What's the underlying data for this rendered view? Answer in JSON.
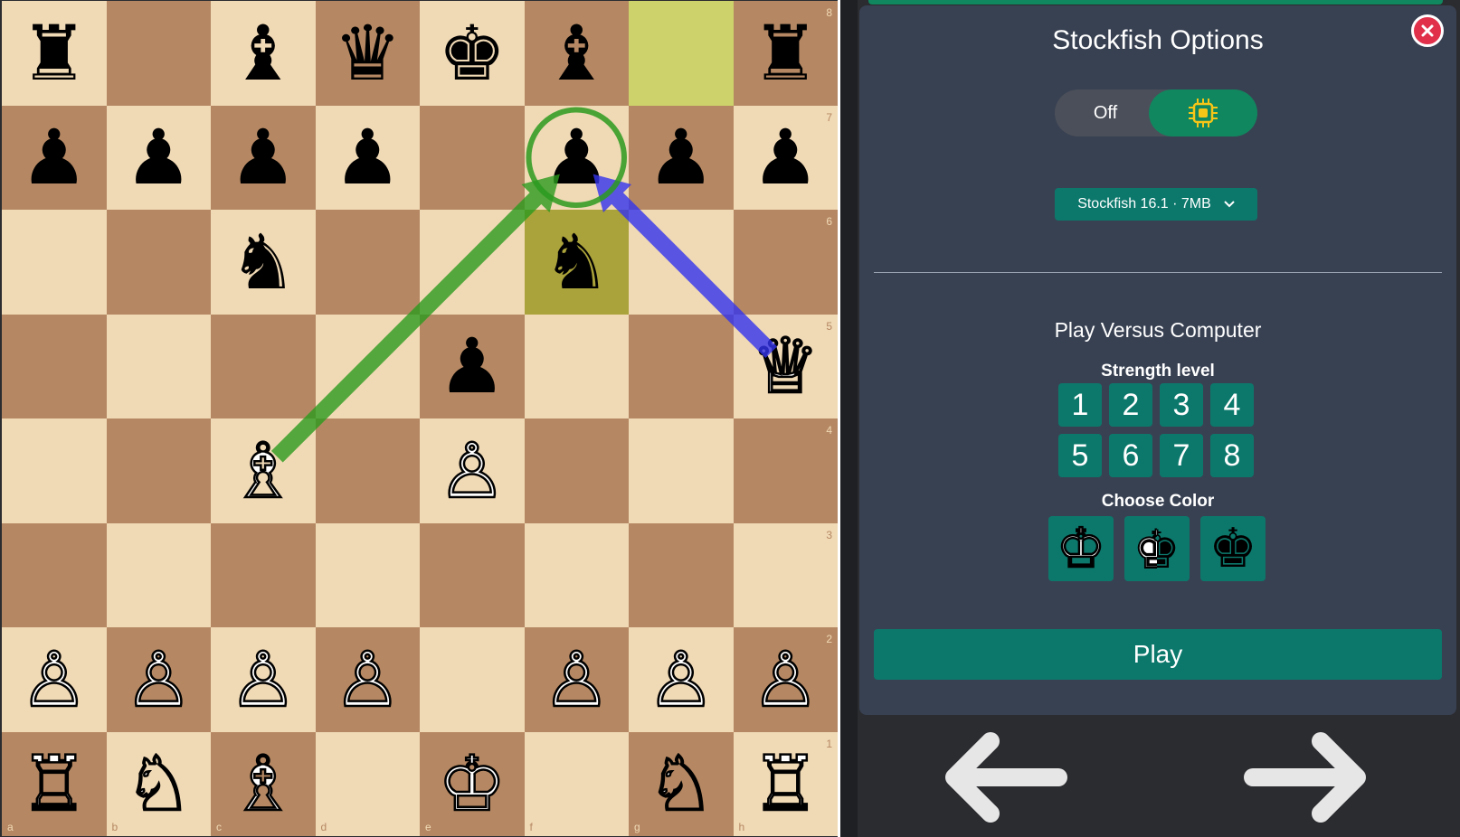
{
  "board": {
    "files": [
      "a",
      "b",
      "c",
      "d",
      "e",
      "f",
      "g",
      "h"
    ],
    "ranks": [
      "8",
      "7",
      "6",
      "5",
      "4",
      "3",
      "2",
      "1"
    ],
    "rows": [
      [
        "r",
        "",
        "b",
        "q",
        "k",
        "b",
        "",
        "r"
      ],
      [
        "p",
        "p",
        "p",
        "p",
        "",
        "p",
        "p",
        "p"
      ],
      [
        "",
        "",
        "n",
        "",
        "",
        "n",
        "",
        ""
      ],
      [
        "",
        "",
        "",
        "",
        "p",
        "",
        "",
        "Q"
      ],
      [
        "",
        "",
        "B",
        "",
        "P",
        "",
        "",
        ""
      ],
      [
        "",
        "",
        "",
        "",
        "",
        "",
        "",
        ""
      ],
      [
        "P",
        "P",
        "P",
        "P",
        "",
        "P",
        "P",
        "P"
      ],
      [
        "R",
        "N",
        "B",
        "",
        "K",
        "",
        "N",
        "R"
      ]
    ],
    "highlight_squares": [
      "g8",
      "f6"
    ],
    "arrows": [
      {
        "from": "c4",
        "to": "f7",
        "color": "#2c9a1e"
      },
      {
        "from": "h5",
        "to": "f7",
        "color": "#3333ee"
      }
    ],
    "circle": {
      "square": "f7",
      "color": "#2c9a1e"
    }
  },
  "panel": {
    "title": "Stockfish Options",
    "toggle_label": "Off",
    "engine": "Stockfish 16.1 ·  7MB",
    "section_title": "Play Versus Computer",
    "strength_label": "Strength level",
    "levels": [
      "1",
      "2",
      "3",
      "4",
      "5",
      "6",
      "7",
      "8"
    ],
    "color_label": "Choose Color",
    "play_label": "Play",
    "accent": "#0c786c",
    "close_color": "#e0304a"
  },
  "icons": {
    "close": "close-icon",
    "engine_chip": "chip-icon",
    "dropdown": "chevron-down-icon",
    "prev": "arrow-left-icon",
    "next": "arrow-right-icon"
  }
}
